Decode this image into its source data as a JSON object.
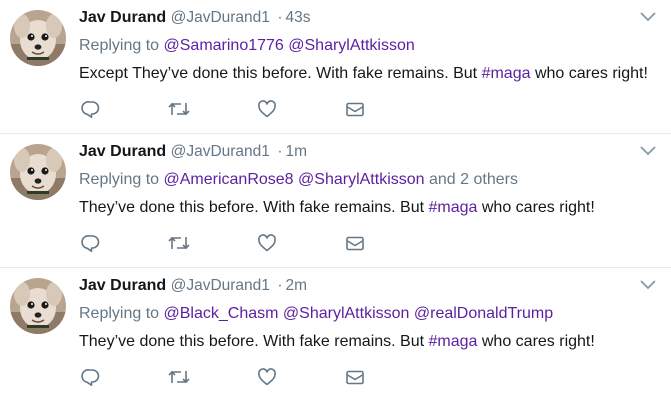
{
  "tweets": [
    {
      "fullname": "Jav Durand",
      "handle": "@JavDurand1",
      "separator": "·",
      "time": "43s",
      "replying_label": "Replying to",
      "mentions": [
        "@Samarino1776",
        "@SharylAttkisson"
      ],
      "others": "",
      "text_before": "Except They’ve done this before. With fake remains. But ",
      "hashtag": "#maga",
      "text_after": " who cares right!"
    },
    {
      "fullname": "Jav Durand",
      "handle": "@JavDurand1",
      "separator": "·",
      "time": "1m",
      "replying_label": "Replying to",
      "mentions": [
        "@AmericanRose8",
        "@SharylAttkisson"
      ],
      "others": "and 2 others",
      "text_before": "They’ve done this before. With fake remains. But ",
      "hashtag": "#maga",
      "text_after": " who cares right!"
    },
    {
      "fullname": "Jav Durand",
      "handle": "@JavDurand1",
      "separator": "·",
      "time": "2m",
      "replying_label": "Replying to",
      "mentions": [
        "@Black_Chasm",
        "@SharylAttkisson",
        "@realDonaldTrump"
      ],
      "others": "",
      "text_before": "They’ve done this before. With fake remains. But ",
      "hashtag": "#maga",
      "text_after": " who cares right!"
    }
  ],
  "icons": {
    "reply": "reply-icon",
    "retweet": "retweet-icon",
    "like": "heart-icon",
    "dm": "envelope-icon",
    "more": "chevron-down-icon"
  },
  "colors": {
    "link": "#5b1fa0",
    "muted": "#657786",
    "text": "#14171a",
    "divider": "#e6ecf0"
  }
}
